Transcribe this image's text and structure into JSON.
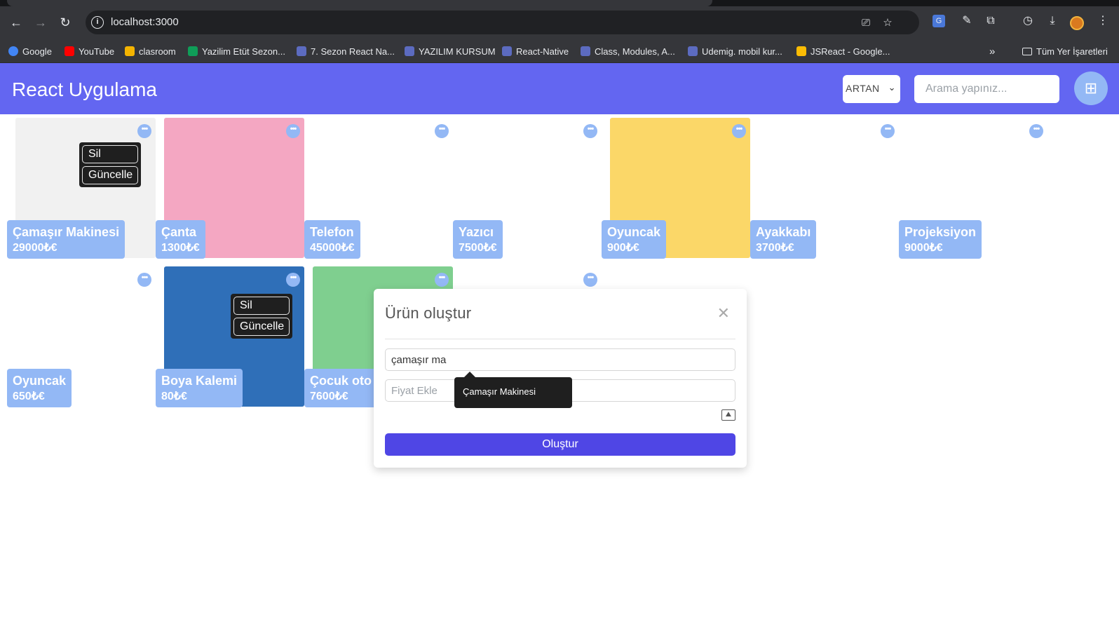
{
  "browser": {
    "url": "localhost:3000",
    "bookmarks": [
      {
        "label": "Google",
        "color": "#4285f4"
      },
      {
        "label": "YouTube",
        "color": "#ff0000"
      },
      {
        "label": "clasroom",
        "color": "#f4b400"
      },
      {
        "label": "Yazilim Etüt Sezon...",
        "color": "#0f9d58"
      },
      {
        "label": "7. Sezon React Na...",
        "color": "#5c6bc0"
      },
      {
        "label": "YAZILIM KURSUM",
        "color": "#5c6bc0"
      },
      {
        "label": "React-Native",
        "color": "#5c6bc0"
      },
      {
        "label": "Class, Modules, A...",
        "color": "#5c6bc0"
      },
      {
        "label": "Udemig. mobil kur...",
        "color": "#5c6bc0"
      },
      {
        "label": "JSReact - Google...",
        "color": "#fbbc04"
      }
    ],
    "overflow": "»",
    "all_bookmarks": "Tüm Yer İşaretleri"
  },
  "header": {
    "title": "React Uygulama",
    "sort_value": "ARTAN",
    "search_placeholder": "Arama yapınız..."
  },
  "products": [
    {
      "name": "Çamaşır Makinesi",
      "price": "29000₺€",
      "bg": "#f1f1f1",
      "icon": "washing-machine"
    },
    {
      "name": "Çanta",
      "price": "1300₺€",
      "bg": "#f4a7c2",
      "icon": "backpack"
    },
    {
      "name": "Telefon",
      "price": "45000₺€",
      "bg": "#ffffff",
      "icon": "phone"
    },
    {
      "name": "Yazıcı",
      "price": "7500₺€",
      "bg": "#ffffff",
      "icon": "printer"
    },
    {
      "name": "Oyuncak",
      "price": "900₺€",
      "bg": "#fbd768",
      "icon": "toy-blocks"
    },
    {
      "name": "Ayakkabı",
      "price": "3700₺€",
      "bg": "#ffffff",
      "icon": "sneaker"
    },
    {
      "name": "Projeksiyon",
      "price": "9000₺€",
      "bg": "#ffffff",
      "icon": "projector"
    },
    {
      "name": "Oyuncak",
      "price": "650₺€",
      "bg": "#ffffff",
      "icon": "rc-car"
    },
    {
      "name": "Boya Kalemi",
      "price": "80₺€",
      "bg": "#2f6fb8",
      "icon": "crayons"
    },
    {
      "name": "Çocuk oto",
      "price": "7600₺€",
      "bg": "#7fcf8f",
      "icon": "car-seat"
    },
    {
      "name": "",
      "price": "",
      "bg": "#ffffff",
      "icon": ""
    }
  ],
  "menu": {
    "delete": "Sil",
    "update": "Güncelle"
  },
  "modal": {
    "title": "Ürün oluştur",
    "name_value": "çamaşır ma",
    "price_placeholder": "Fiyat Ekle",
    "submit": "Oluştur"
  },
  "tooltip": "Çamaşır Makinesi"
}
